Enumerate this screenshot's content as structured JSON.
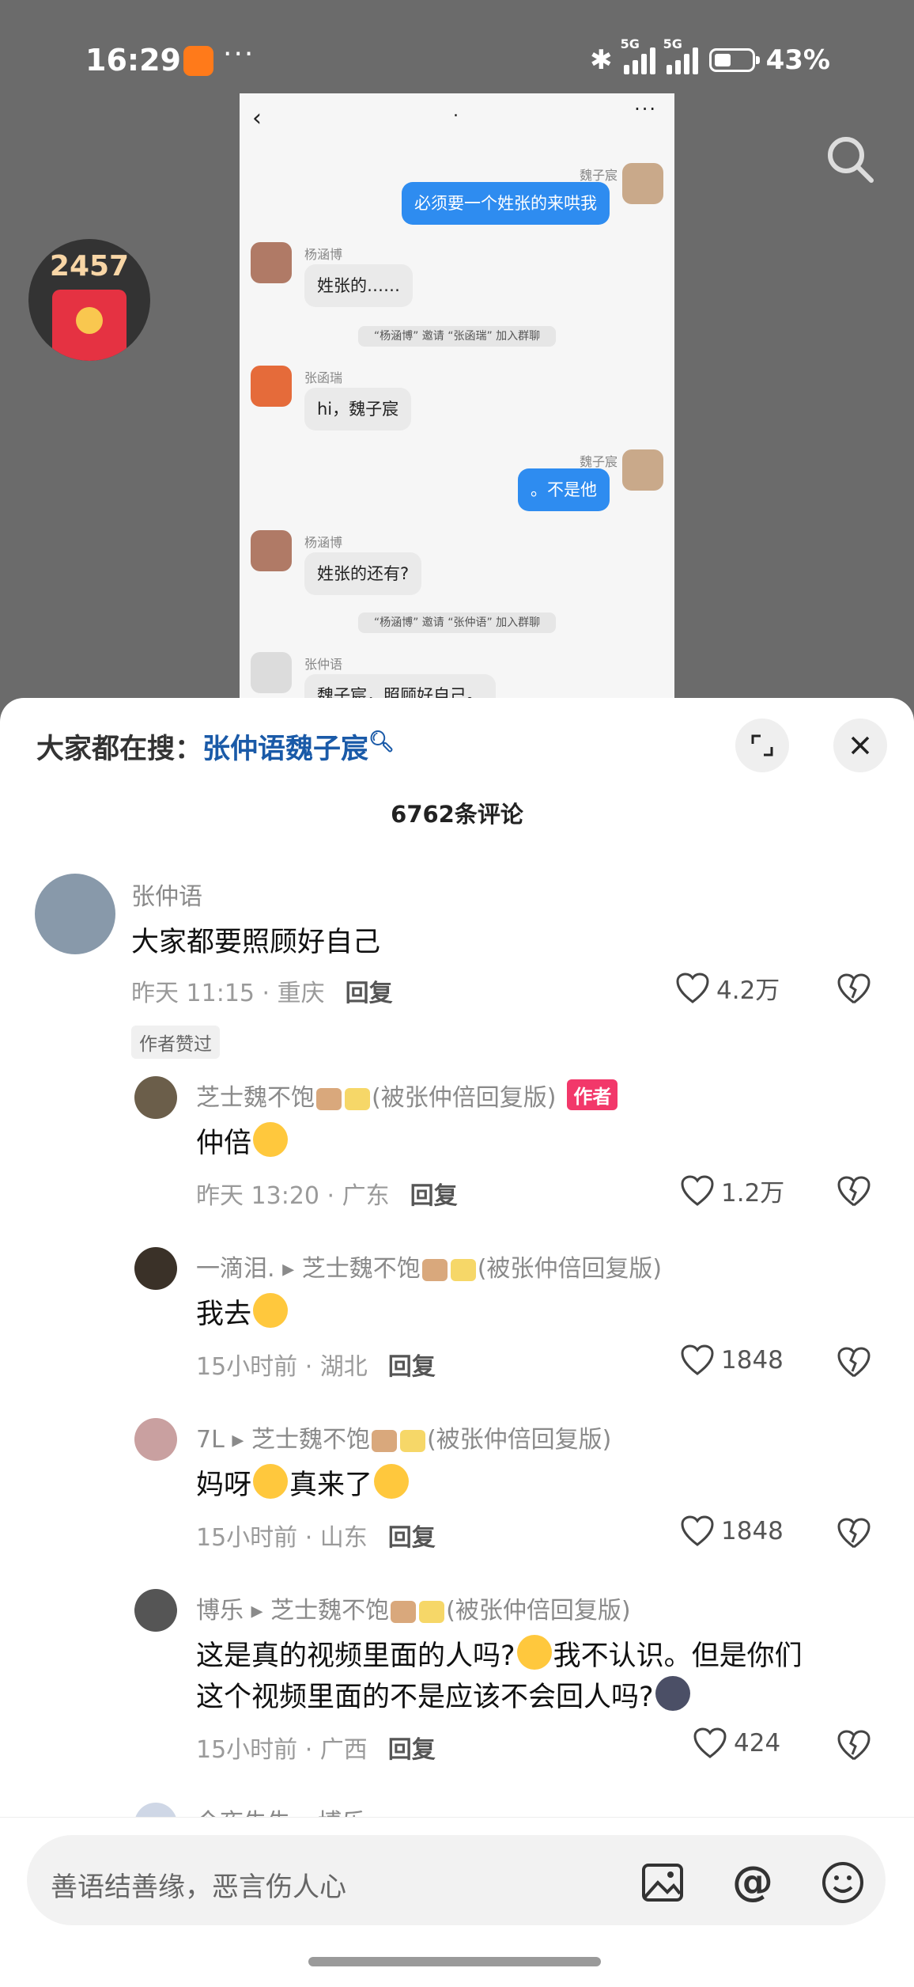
{
  "status": {
    "time": "16:29",
    "net1": "5G",
    "net2": "5G",
    "battery": "43%"
  },
  "red_packet": {
    "count": "2457"
  },
  "embedded_chat": {
    "title": ".",
    "messages": [
      {
        "name": "魏子宸",
        "text": "必须要一个姓张的来哄我"
      },
      {
        "name": "杨涵博",
        "text": "姓张的……"
      },
      {
        "system": "“杨涵博” 邀请 “张函瑞” 加入群聊"
      },
      {
        "name": "张函瑞",
        "text": "hi，魏子宸"
      },
      {
        "name": "魏子宸",
        "text": "。不是他"
      },
      {
        "name": "杨涵博",
        "text": "姓张的还有?"
      },
      {
        "system": "“杨涵博” 邀请 “张仲语” 加入群聊"
      },
      {
        "name": "张仲语",
        "text": "魏子宸，照顾好自己。"
      }
    ]
  },
  "sheet": {
    "suggest_prefix": "大家都在搜：",
    "suggest_keyword": "张仲语魏子宸",
    "comment_count": "6762条评论",
    "reply_label": "回复",
    "author_tag": "作者",
    "liked_tag": "作者赞过",
    "comments": [
      {
        "name": "张仲语",
        "text": "大家都要照顾好自己",
        "meta": "昨天 11:15 · 重庆",
        "likes": "4.2万"
      },
      {
        "name": "芝士魏不饱",
        "name_suffix": "(被张仲倍回复版)",
        "text": "仲倍",
        "meta": "昨天 13:20 · 广东",
        "likes": "1.2万"
      },
      {
        "name": "一滴泪.",
        "reply_to": "芝士魏不饱",
        "reply_suffix": "(被张仲倍回复版)",
        "text": "我去",
        "meta": "15小时前 · 湖北",
        "likes": "1848"
      },
      {
        "name": "7L",
        "reply_to": "芝士魏不饱",
        "reply_suffix": "(被张仲倍回复版)",
        "text_a": "妈呀",
        "text_b": "真来了",
        "meta": "15小时前 · 山东",
        "likes": "1848"
      },
      {
        "name": "博乐",
        "reply_to": "芝士魏不饱",
        "reply_suffix": "(被张仲倍回复版)",
        "text_a": "这是真的视频里面的人吗?",
        "text_b": "我不认识。但是你们",
        "text_c": "这个视频里面的不是应该不会回人吗?",
        "meta": "15小时前 · 广西",
        "likes": "424"
      },
      {
        "name": "今夜失失",
        "reply_to": "博乐"
      }
    ]
  },
  "input": {
    "placeholder": "善语结善缘，恶言伤人心"
  }
}
